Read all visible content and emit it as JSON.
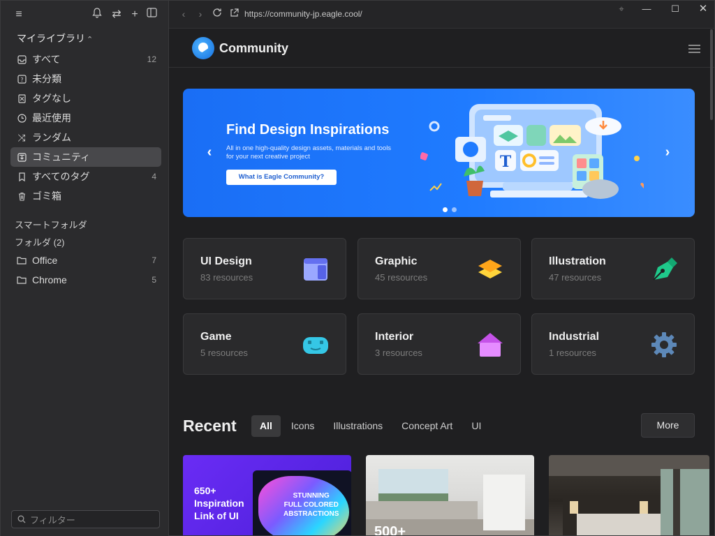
{
  "sidebar": {
    "library_title": "マイライブラリ",
    "library_chevron": "⌃⌄",
    "nav": [
      {
        "label": "すべて",
        "count": "12",
        "icon": "inbox-icon"
      },
      {
        "label": "未分類",
        "count": "",
        "icon": "question-box-icon"
      },
      {
        "label": "タグなし",
        "count": "",
        "icon": "untagged-icon"
      },
      {
        "label": "最近使用",
        "count": "",
        "icon": "clock-icon"
      },
      {
        "label": "ランダム",
        "count": "",
        "icon": "shuffle-icon"
      },
      {
        "label": "コミュニティ",
        "count": "",
        "icon": "community-icon"
      },
      {
        "label": "すべてのタグ",
        "count": "4",
        "icon": "bookmark-icon"
      },
      {
        "label": "ゴミ箱",
        "count": "",
        "icon": "trash-icon"
      }
    ],
    "smart_folder_label": "スマートフォルダ",
    "folder_label": "フォルダ (2)",
    "folders": [
      {
        "label": "Office",
        "count": "7"
      },
      {
        "label": "Chrome",
        "count": "5"
      }
    ],
    "filter_placeholder": "フィルター"
  },
  "topbar": {
    "url": "https://community-jp.eagle.cool/"
  },
  "content": {
    "brand": "Community",
    "banner": {
      "title": "Find Design Inspirations",
      "text": "All in one high-quality design assets, materials and tools for your next creative project",
      "cta": "What is Eagle Community?"
    },
    "categories": [
      {
        "title": "UI Design",
        "sub": "83 resources",
        "icon": "ui-design-icon",
        "color": "#7b8cff"
      },
      {
        "title": "Graphic",
        "sub": "45 resources",
        "icon": "layers-icon",
        "color": "#ffc21a"
      },
      {
        "title": "Illustration",
        "sub": "47 resources",
        "icon": "pen-nib-icon",
        "color": "#1fc98b"
      },
      {
        "title": "Game",
        "sub": "5 resources",
        "icon": "gamepad-icon",
        "color": "#35c7e6"
      },
      {
        "title": "Interior",
        "sub": "3 resources",
        "icon": "house-icon",
        "color": "#d66bf2"
      },
      {
        "title": "Industrial",
        "sub": "1 resources",
        "icon": "gear-icon",
        "color": "#5d88b8"
      }
    ],
    "recent_title": "Recent",
    "tabs": [
      "All",
      "Icons",
      "Illustrations",
      "Concept Art",
      "UI"
    ],
    "more": "More",
    "thumb1_text": "650+ Inspiration Link of UI",
    "thumb1_sub": "STUNNING FULL COLORED ABSTRACTIONS",
    "thumb2_text": "500+"
  }
}
